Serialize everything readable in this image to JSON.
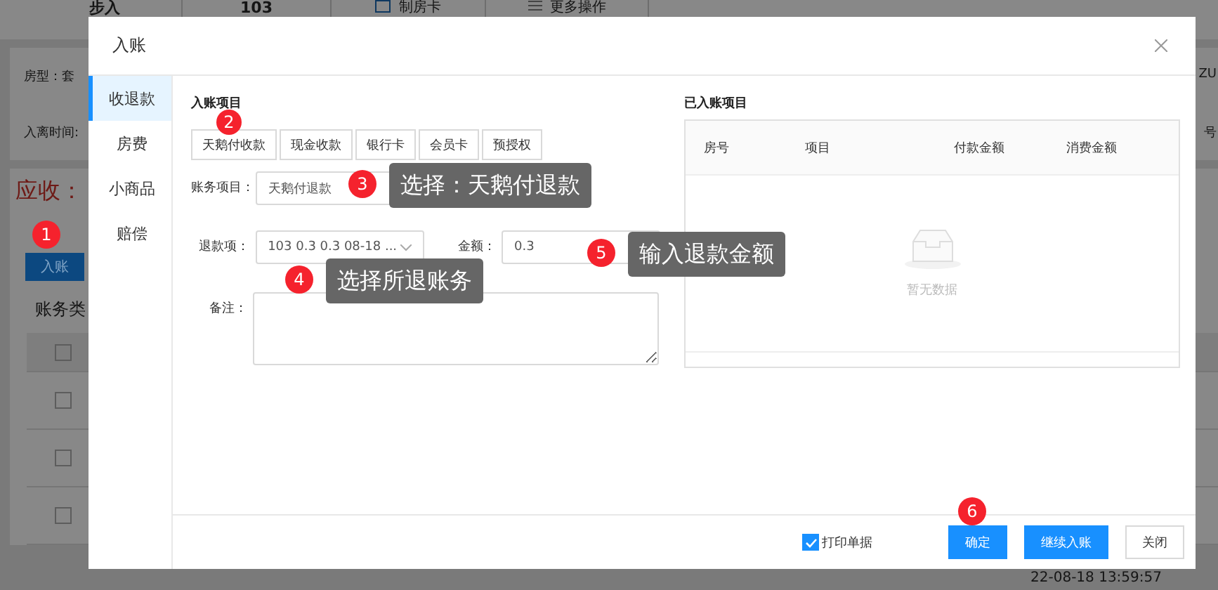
{
  "background": {
    "top_bar": [
      {
        "label": "步入",
        "kind": "title"
      },
      {
        "label": "103",
        "kind": "title"
      },
      {
        "label": "制房卡",
        "kind": "card"
      },
      {
        "label": "更多操作",
        "kind": "menu"
      }
    ],
    "room_type": "房型：套",
    "stay_time": "入离时间:",
    "right_labels": [
      "ZU",
      "号"
    ],
    "receivable": "应收：",
    "post_button": "入账",
    "section_title": "账务类",
    "rows": [
      {
        "checked": false
      },
      {
        "checked": false
      },
      {
        "checked": false
      },
      {
        "checked": false
      }
    ],
    "last_row_time": "22-08-18 13:59:57"
  },
  "dialog": {
    "title": "入账",
    "tabs": [
      {
        "label": "收退款",
        "selected": true
      },
      {
        "label": "房费",
        "selected": false
      },
      {
        "label": "小商品",
        "selected": false
      },
      {
        "label": "赔偿",
        "selected": false
      }
    ],
    "section_title": "入账项目",
    "methods": [
      "天鹅付收款",
      "现金收款",
      "银行卡",
      "会员卡",
      "预授权"
    ],
    "account_item": {
      "label": "账务项目：",
      "value": "天鹅付退款"
    },
    "refund_item": {
      "label": "退款项：",
      "value": "103 0.3 0.3 08-18 ..."
    },
    "amount": {
      "label": "金额：",
      "value": "0.3"
    },
    "remark": {
      "label": "备注："
    },
    "posted": {
      "title": "已入账项目",
      "columns": [
        "房号",
        "项目",
        "付款金额",
        "消费金额"
      ],
      "empty_text": "暂无数据"
    },
    "print_receipt": {
      "label": "打印单据",
      "checked": true
    },
    "buttons": [
      {
        "label": "确定",
        "kind": "primary"
      },
      {
        "label": "继续入账",
        "kind": "primary"
      },
      {
        "label": "关闭",
        "kind": "plain"
      }
    ]
  },
  "annotations": [
    {
      "number": "1"
    },
    {
      "number": "2"
    },
    {
      "number": "3",
      "note": "选择：天鹅付退款"
    },
    {
      "number": "4",
      "note": "选择所退账务"
    },
    {
      "number": "5",
      "note": "输入退款金额"
    },
    {
      "number": "6"
    }
  ]
}
